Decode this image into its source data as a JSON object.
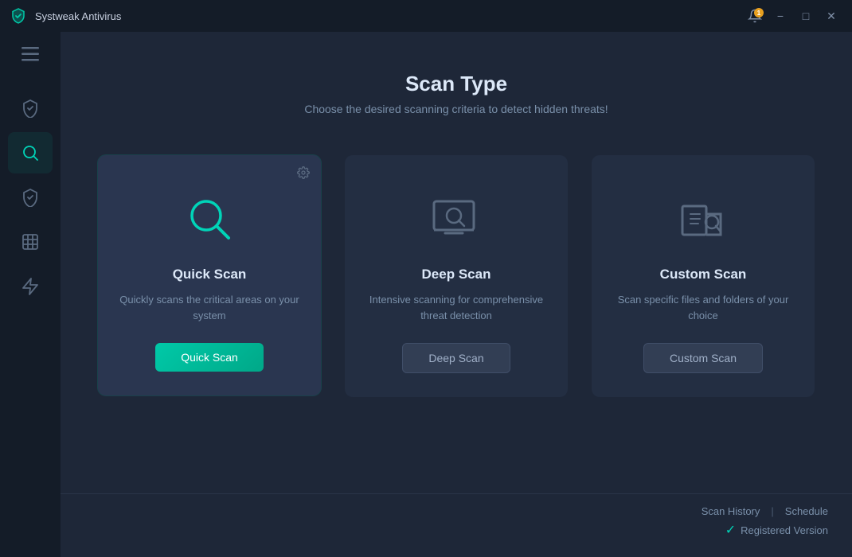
{
  "titleBar": {
    "appName": "Systweak Antivirus",
    "notificationCount": "1",
    "minimizeLabel": "−",
    "maximizeLabel": "□",
    "closeLabel": "✕"
  },
  "sidebar": {
    "menuLabel": "☰",
    "items": [
      {
        "name": "protection",
        "label": "Protection",
        "active": false
      },
      {
        "name": "scan",
        "label": "Scan",
        "active": true
      },
      {
        "name": "shield",
        "label": "Shield",
        "active": false
      },
      {
        "name": "firewall",
        "label": "Firewall",
        "active": false
      },
      {
        "name": "boost",
        "label": "Boost",
        "active": false
      }
    ]
  },
  "page": {
    "title": "Scan Type",
    "subtitle": "Choose the desired scanning criteria to detect hidden threats!"
  },
  "scanCards": [
    {
      "id": "quick",
      "title": "Quick Scan",
      "description": "Quickly scans the critical areas on your system",
      "buttonLabel": "Quick Scan",
      "buttonType": "primary",
      "active": true,
      "hasSettings": true
    },
    {
      "id": "deep",
      "title": "Deep Scan",
      "description": "Intensive scanning for comprehensive threat detection",
      "buttonLabel": "Deep Scan",
      "buttonType": "secondary",
      "active": false,
      "hasSettings": false
    },
    {
      "id": "custom",
      "title": "Custom Scan",
      "description": "Scan specific files and folders of your choice",
      "buttonLabel": "Custom Scan",
      "buttonType": "secondary",
      "active": false,
      "hasSettings": false
    }
  ],
  "footer": {
    "scanHistoryLabel": "Scan History",
    "separatorLabel": "|",
    "scheduleLabel": "Schedule",
    "statusIcon": "✓",
    "statusText": "Registered Version"
  }
}
